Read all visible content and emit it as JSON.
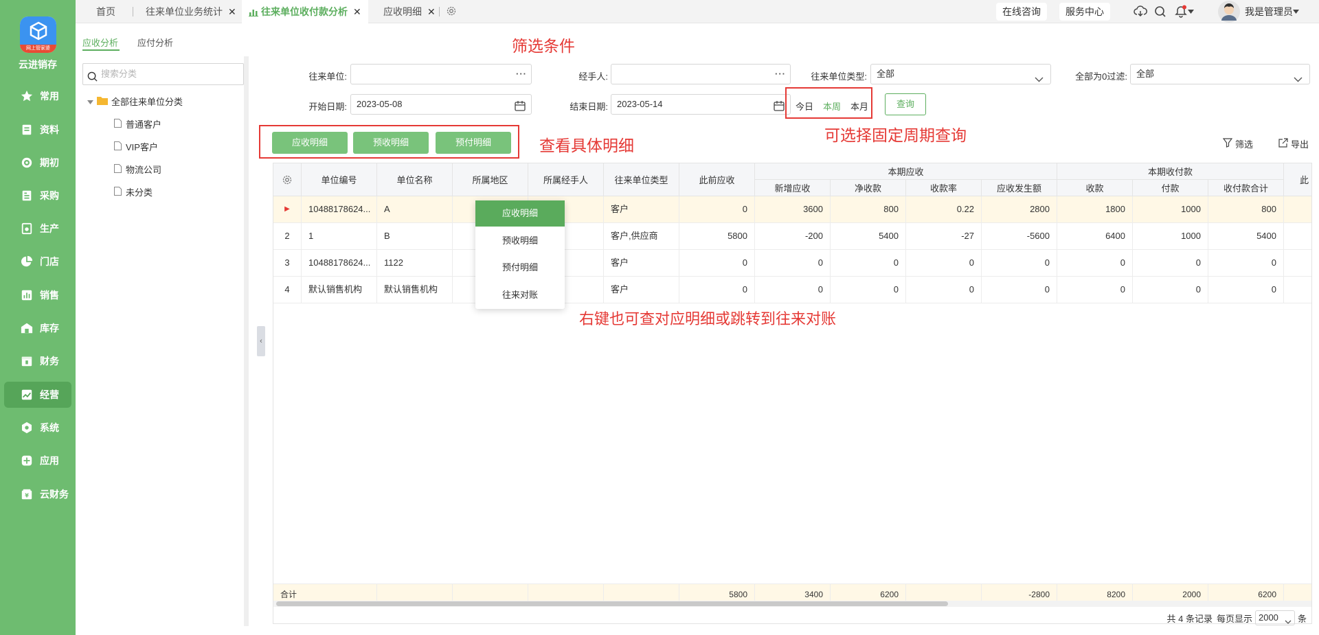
{
  "brand": {
    "name": "云进销存",
    "ribbon": "网上管家婆"
  },
  "sidebar": {
    "items": [
      {
        "label": "常用",
        "icon": "star-icon"
      },
      {
        "label": "资料",
        "icon": "document-icon"
      },
      {
        "label": "期初",
        "icon": "target-icon"
      },
      {
        "label": "采购",
        "icon": "purchase-icon"
      },
      {
        "label": "生产",
        "icon": "production-icon"
      },
      {
        "label": "门店",
        "icon": "pie-icon"
      },
      {
        "label": "销售",
        "icon": "bar-chart-icon"
      },
      {
        "label": "库存",
        "icon": "warehouse-icon"
      },
      {
        "label": "财务",
        "icon": "finance-icon"
      },
      {
        "label": "经营",
        "icon": "trend-icon"
      },
      {
        "label": "系统",
        "icon": "settings-icon"
      },
      {
        "label": "应用",
        "icon": "plus-box-icon"
      },
      {
        "label": "云财务",
        "icon": "cloud-finance-icon"
      }
    ],
    "active": "经营"
  },
  "tabs": [
    {
      "label": "首页"
    },
    {
      "label": "往来单位业务统计"
    },
    {
      "label": "往来单位收付款分析"
    },
    {
      "label": "应收明细"
    }
  ],
  "header": {
    "online": "在线咨询",
    "service": "服务中心",
    "user": "我是管理员"
  },
  "left": {
    "subtabs": [
      "应收分析",
      "应付分析"
    ],
    "search_placeholder": "搜索分类",
    "tree_root": "全部往来单位分类",
    "tree_children": [
      "普通客户",
      "VIP客户",
      "物流公司",
      "未分类"
    ]
  },
  "filters": {
    "unit_label": "往来单位:",
    "unit_value": "",
    "handler_label": "经手人:",
    "handler_value": "",
    "type_label": "往来单位类型:",
    "type_value": "全部",
    "zero_label": "全部为0过滤:",
    "zero_value": "全部",
    "start_label": "开始日期:",
    "start_value": "2023-05-08",
    "end_label": "结束日期:",
    "end_value": "2023-05-14",
    "periods": [
      "今日",
      "本周",
      "本月"
    ],
    "active_period": "本周",
    "query": "查询"
  },
  "annotations": {
    "filter": "筛选条件",
    "detail": "查看具体明细",
    "period": "可选择固定周期查询",
    "context": "右键也可查对应明细或跳转到往来对账"
  },
  "actions": [
    "应收明细",
    "预收明细",
    "预付明细"
  ],
  "toolbar": {
    "filter": "筛选",
    "export": "导出"
  },
  "table": {
    "group_headers": {
      "current_receivable": "本期应收",
      "current_payment": "本期收付款"
    },
    "headers": [
      "单位编号",
      "单位名称",
      "所属地区",
      "所属经手人",
      "往来单位类型",
      "此前应收",
      "新增应收",
      "净收款",
      "收款率",
      "应收发生额",
      "收款",
      "付款",
      "收付款合计",
      "此"
    ],
    "rows": [
      {
        "no": "▶",
        "code": "10488178624...",
        "name": "A",
        "region": "",
        "handler": "",
        "type": "客户",
        "prev": "0",
        "add": "3600",
        "net": "800",
        "rate": "0.22",
        "occur": "2800",
        "recv": "1800",
        "pay": "1000",
        "total": "800"
      },
      {
        "no": "2",
        "code": "1",
        "name": "B",
        "region": "",
        "handler": "",
        "type": "客户,供应商",
        "prev": "5800",
        "add": "-200",
        "net": "5400",
        "rate": "-27",
        "occur": "-5600",
        "recv": "6400",
        "pay": "1000",
        "total": "5400"
      },
      {
        "no": "3",
        "code": "10488178624...",
        "name": "1122",
        "region": "",
        "handler": "",
        "type": "客户",
        "prev": "0",
        "add": "0",
        "net": "0",
        "rate": "0",
        "occur": "0",
        "recv": "0",
        "pay": "0",
        "total": "0"
      },
      {
        "no": "4",
        "code": "默认销售机构",
        "name": "默认销售机构",
        "region": "",
        "handler": "",
        "type": "客户",
        "prev": "0",
        "add": "0",
        "net": "0",
        "rate": "0",
        "occur": "0",
        "recv": "0",
        "pay": "0",
        "total": "0"
      }
    ],
    "footer": {
      "label": "合计",
      "prev": "5800",
      "add": "3400",
      "net": "6200",
      "rate": "",
      "occur": "-2800",
      "recv": "8200",
      "pay": "2000",
      "total": "6200"
    }
  },
  "context_menu": [
    "应收明细",
    "预收明细",
    "预付明细",
    "往来对账"
  ],
  "pager": {
    "summary": "共 4 条记录",
    "per_page_label": "每页显示",
    "per_page": "2000",
    "unit": "条"
  },
  "colors": {
    "sidebar": "#6ebc70",
    "accent": "#5cae5e",
    "annotation": "#e53935",
    "selected_row": "#fff8e6"
  }
}
